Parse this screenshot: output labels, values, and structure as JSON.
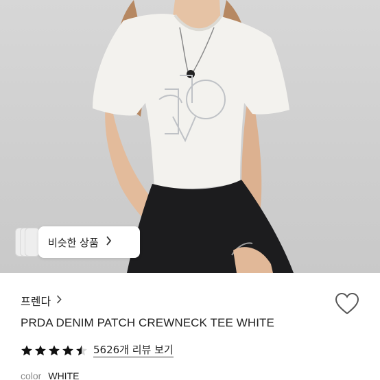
{
  "product": {
    "brand": "프렌다",
    "title": "PRDA DENIM PATCH CREWNECK TEE WHITE",
    "rating_value": 4.5,
    "review_link": "5626개 리뷰 보기",
    "color_label": "color",
    "color_value": "WHITE"
  },
  "similar_button": {
    "label": "비슷한 상품"
  },
  "icons": {
    "brand_chevron": "chevron-right-icon",
    "heart": "heart-icon",
    "similar_chevron": "chevron-right-icon"
  },
  "colors": {
    "text": "#222222",
    "muted": "#888888",
    "background": "#ffffff"
  }
}
